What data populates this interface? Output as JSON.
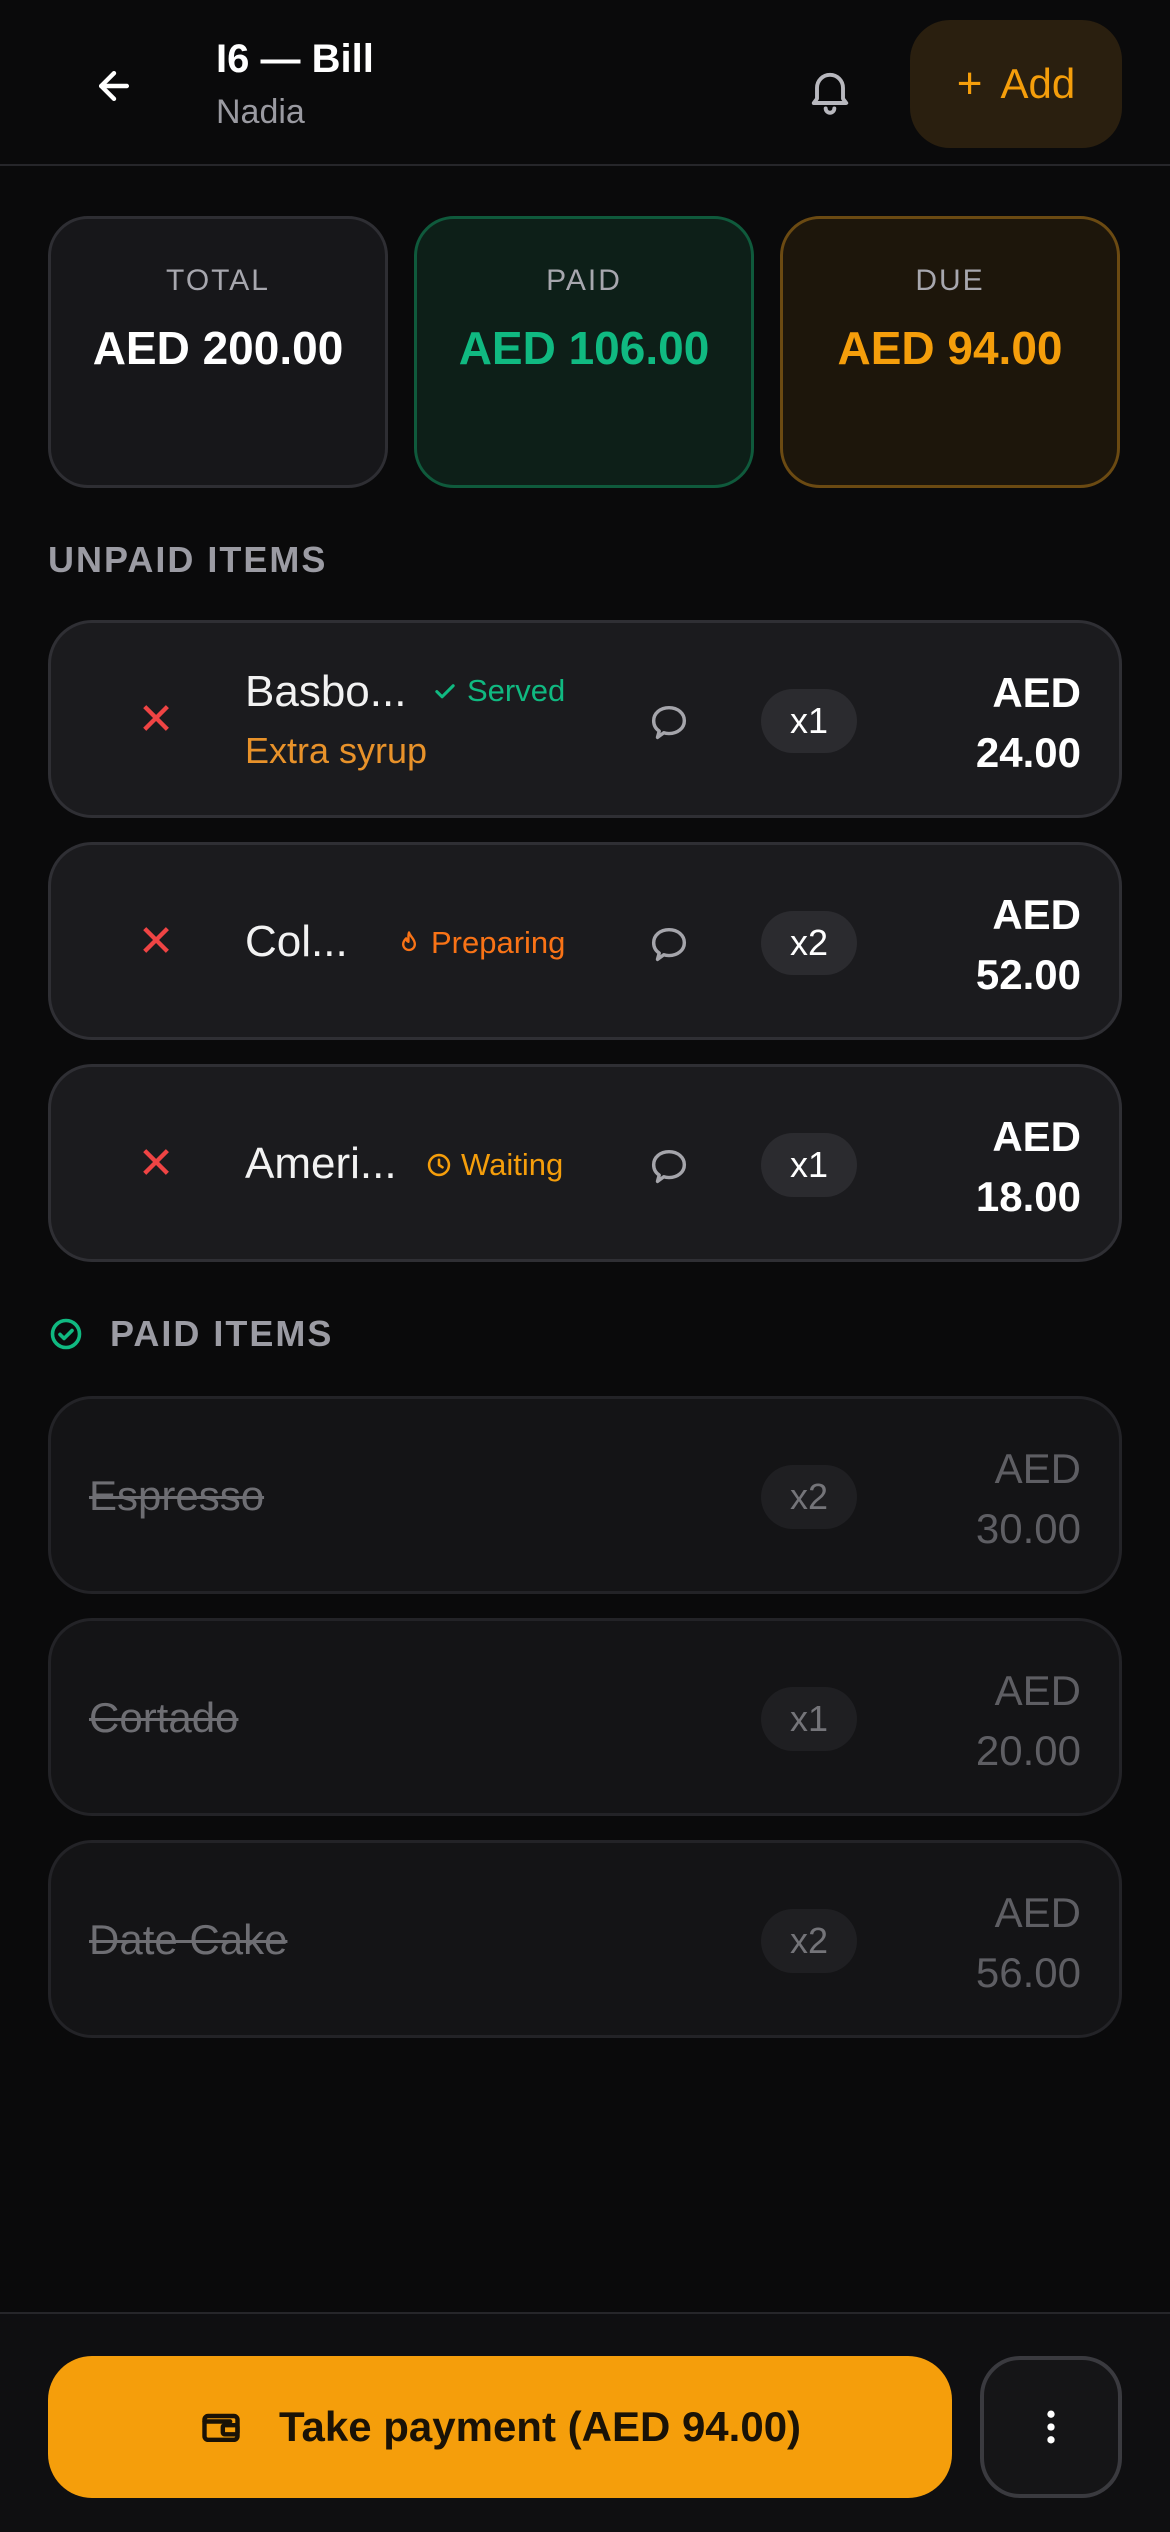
{
  "header": {
    "title": "I6 — Bill",
    "subtitle": "Nadia",
    "add_label": "Add",
    "add_plus": "+"
  },
  "summary": {
    "total_label": "TOTAL",
    "total_value": "AED 200.00",
    "paid_label": "PAID",
    "paid_value": "AED 106.00",
    "due_label": "DUE",
    "due_value": "AED 94.00"
  },
  "unpaid": {
    "heading": "UNPAID ITEMS",
    "items": [
      {
        "name": "Basbo...",
        "status": "Served",
        "status_color": "#10b981",
        "status_icon": "check-icon",
        "note": "Extra syrup",
        "qty": "x1",
        "price_currency": "AED",
        "price_amount": "24.00",
        "remove_glyph": "✕"
      },
      {
        "name": "Col...",
        "status": "Preparing",
        "status_color": "#f97316",
        "status_icon": "flame-icon",
        "note": "",
        "qty": "x2",
        "price_currency": "AED",
        "price_amount": "52.00",
        "remove_glyph": "✕"
      },
      {
        "name": "Ameri...",
        "status": "Waiting",
        "status_color": "#f59e0b",
        "status_icon": "clock-icon",
        "note": "",
        "qty": "x1",
        "price_currency": "AED",
        "price_amount": "18.00",
        "remove_glyph": "✕"
      }
    ]
  },
  "paid": {
    "heading": "PAID ITEMS",
    "items": [
      {
        "name": "Espresso",
        "qty": "x2",
        "price_currency": "AED",
        "price_amount": "30.00"
      },
      {
        "name": "Cortado",
        "qty": "x1",
        "price_currency": "AED",
        "price_amount": "20.00"
      },
      {
        "name": "Date Cake",
        "qty": "x2",
        "price_currency": "AED",
        "price_amount": "56.00"
      }
    ]
  },
  "footer": {
    "pay_label": "Take payment (AED 94.00)"
  },
  "colors": {
    "accent": "#f59e0b",
    "paid_green": "#10b981",
    "remove_red": "#ef4444"
  }
}
